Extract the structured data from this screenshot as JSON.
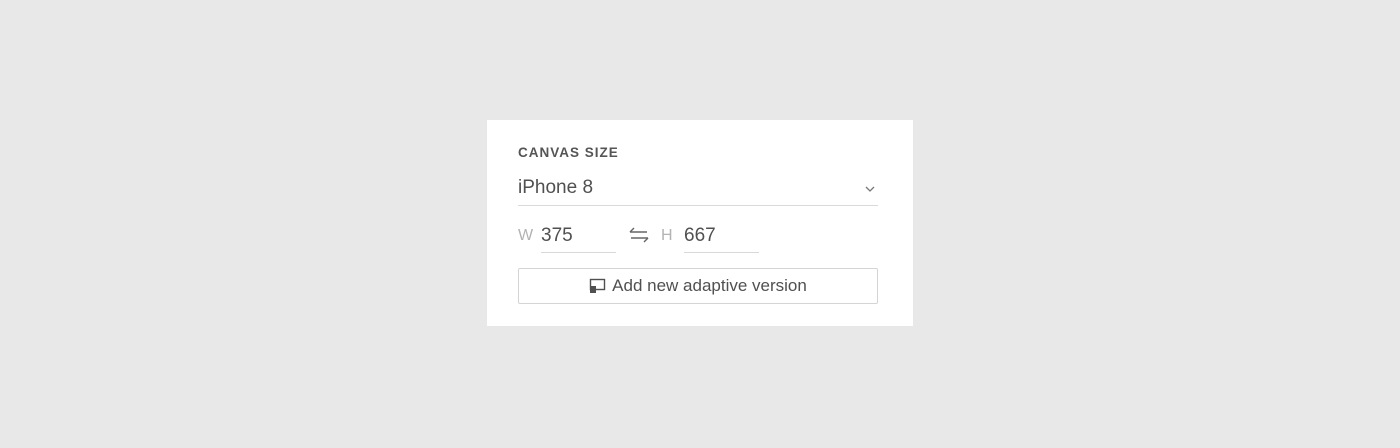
{
  "canvas_size": {
    "title": "CANVAS SIZE",
    "preset": "iPhone 8",
    "width_label": "W",
    "width_value": "375",
    "height_label": "H",
    "height_value": "667",
    "add_adaptive_label": "Add new adaptive version"
  },
  "icons": {
    "preset_dropdown": "chevron-down-icon",
    "swap": "swap-dimensions-icon",
    "adaptive": "adaptive-version-icon"
  },
  "colors": {
    "background": "#e8e8e8",
    "panel": "#ffffff",
    "text": "#505050",
    "muted": "#b3b3b3",
    "divider": "#d9d9d9"
  }
}
